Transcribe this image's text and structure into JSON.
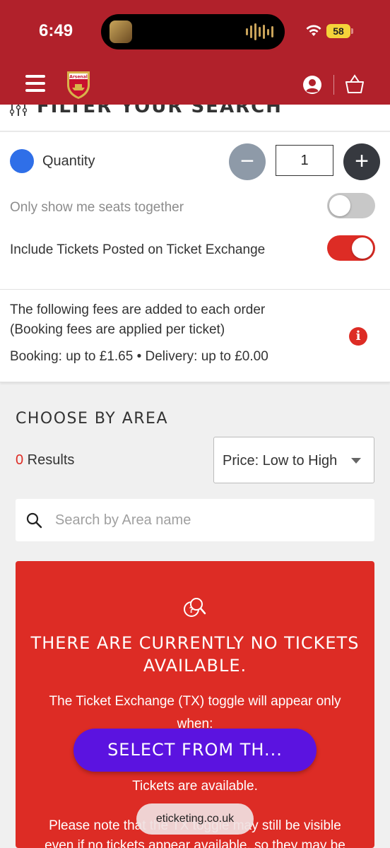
{
  "status_bar": {
    "time": "6:49",
    "battery": "58"
  },
  "header": {
    "menu_icon": "hamburger-menu-icon",
    "logo": "arsenal-crest-icon",
    "logo_text": "Arsenal",
    "account_icon": "account-icon",
    "basket_icon": "basket-icon",
    "brand_color": "#b1212b"
  },
  "filter": {
    "title": "FILTER YOUR SEARCH",
    "quantity_label": "Quantity",
    "quantity_value": "1",
    "minus_label": "−",
    "plus_label": "+",
    "seats_together_label": "Only show me seats together",
    "seats_together_on": false,
    "ticket_exchange_label": "Include Tickets Posted on Ticket Exchange",
    "ticket_exchange_on": true
  },
  "fees": {
    "line1": "The following fees are added to each order",
    "line2": "(Booking fees are applied per ticket)",
    "line3": "Booking: up to £1.65 • Delivery: up to £0.00",
    "info_symbol": "i"
  },
  "area": {
    "title": "CHOOSE BY AREA",
    "results_count": "0",
    "results_label": " Results",
    "sort_value": "Price: Low to High",
    "search_placeholder": "Search by Area name"
  },
  "no_tickets": {
    "heading": "THERE ARE CURRENTLY NO TICKETS AVAILABLE.",
    "line1": "The Ticket Exchange (TX) toggle will appear only",
    "line2": "when:",
    "line3": "Tickets are available.",
    "line4": "Please note that the TX toggle may still be visible",
    "line5": "even if no tickets appear available, so they may be",
    "accent_color": "#dd2c25"
  },
  "select_button": {
    "label": "SELECT FROM TH...",
    "color": "#5b13e0"
  },
  "url_bar": {
    "domain": "eticketing.co.uk"
  }
}
